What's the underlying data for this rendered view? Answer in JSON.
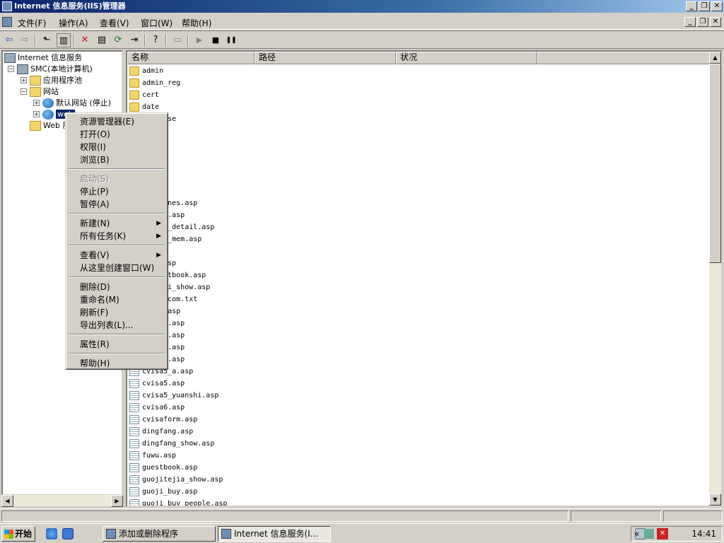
{
  "window": {
    "title": "Internet 信息服务(IIS)管理器"
  },
  "menubar": {
    "items": [
      "文件(F)",
      "操作(A)",
      "查看(V)",
      "窗口(W)",
      "帮助(H)"
    ]
  },
  "window_buttons": {
    "minimize": "_",
    "restore": "❐",
    "close": "✕"
  },
  "toolbar": {
    "icons": [
      "back-arrow",
      "forward-arrow",
      "up-folder",
      "show-hide-tree",
      "delete",
      "properties",
      "refresh",
      "export-list",
      "help",
      "connect",
      "play",
      "stop",
      "pause"
    ],
    "glyphs": {
      "back": "⇦",
      "forward": "⇨",
      "up": "⬑",
      "tree": "▥",
      "delete": "✕",
      "props": "▤",
      "refresh": "⟳",
      "export": "⇥",
      "help": "?",
      "computer": "▭",
      "play": "▶",
      "stop": "■",
      "pause": "❚❚"
    }
  },
  "tree": {
    "root": "Internet 信息服务",
    "computer": "SMC(本地计算机)",
    "app_pools": "应用程序池",
    "websites": "网站",
    "default_site": "默认网站 (停止)",
    "selected_site": "web",
    "web_ext": "Web 服务扩展",
    "expand_glyph": "+",
    "collapse_glyph": "−"
  },
  "list": {
    "columns": [
      "名称",
      "路径",
      "状况"
    ],
    "rows": [
      {
        "name": "admin",
        "type": "folder"
      },
      {
        "name": "admin_reg",
        "type": "folder"
      },
      {
        "name": "cert",
        "type": "folder"
      },
      {
        "name": "date",
        "type": "folder"
      },
      {
        "name": "database",
        "type": "folder"
      },
      {
        "name": "",
        "type": "folder"
      },
      {
        "name": "",
        "type": "folder"
      },
      {
        "name": "",
        "type": "folder"
      },
      {
        "name": "",
        "type": "folder"
      },
      {
        "name": "",
        "type": "folder"
      },
      {
        "name": "",
        "type": "folder"
      },
      {
        "name": "airplanes.asp",
        "type": "file"
      },
      {
        "name": "bottom.asp",
        "type": "file"
      },
      {
        "name": "chuguo_detail.asp",
        "type": "file"
      },
      {
        "name": "chuguo_mem.asp",
        "type": "file"
      },
      {
        "name": "",
        "type": "file"
      },
      {
        "name": "conn.asp",
        "type": "file"
      },
      {
        "name": "cqguestbook.asp",
        "type": "file"
      },
      {
        "name": "cruishi_show.asp",
        "type": "file"
      },
      {
        "name": "cvisa.com.txt",
        "type": "file"
      },
      {
        "name": "cvisa.asp",
        "type": "file"
      },
      {
        "name": "cvisa1.asp",
        "type": "file"
      },
      {
        "name": "cvisa2.asp",
        "type": "file"
      },
      {
        "name": "cvisa3.asp",
        "type": "file"
      },
      {
        "name": "cvisa4.asp",
        "type": "file"
      },
      {
        "name": "cvisa5_a.asp",
        "type": "file"
      },
      {
        "name": "cvisa5.asp",
        "type": "file"
      },
      {
        "name": "cvisa5_yuanshi.asp",
        "type": "file"
      },
      {
        "name": "cvisa6.asp",
        "type": "file"
      },
      {
        "name": "cvisaform.asp",
        "type": "file"
      },
      {
        "name": "dingfang.asp",
        "type": "file"
      },
      {
        "name": "dingfang_show.asp",
        "type": "file"
      },
      {
        "name": "fuwu.asp",
        "type": "file"
      },
      {
        "name": "guestbook.asp",
        "type": "file"
      },
      {
        "name": "guojitejia_show.asp",
        "type": "file"
      },
      {
        "name": "guoji_buy.asp",
        "type": "file"
      },
      {
        "name": "guoji_buy_people.asp",
        "type": "file"
      }
    ]
  },
  "context_menu": {
    "explorer": "资源管理器(E)",
    "open": "打开(O)",
    "permissions": "权限(I)",
    "browse": "浏览(B)",
    "start": "启动(S)",
    "stop": "停止(P)",
    "pause": "暂停(A)",
    "new": "新建(N)",
    "all_tasks": "所有任务(K)",
    "view": "查看(V)",
    "new_window": "从这里创建窗口(W)",
    "delete": "删除(D)",
    "rename": "重命名(M)",
    "refresh": "刷新(F)",
    "export": "导出列表(L)...",
    "properties": "属性(R)",
    "help": "帮助(H)",
    "submenu_arrow": "▶"
  },
  "taskbar": {
    "start": "开始",
    "tasks": [
      "添加或删除程序",
      "Internet 信息服务(I..."
    ],
    "clock": "14:41",
    "tray_chevron": "«"
  },
  "scroll": {
    "up": "▲",
    "down": "▼",
    "left": "◀",
    "right": "▶"
  },
  "colors": {
    "titlebar_start": "#0a246a",
    "titlebar_end": "#a6caf0",
    "face": "#d4d0c8",
    "selection": "#0a246a"
  }
}
